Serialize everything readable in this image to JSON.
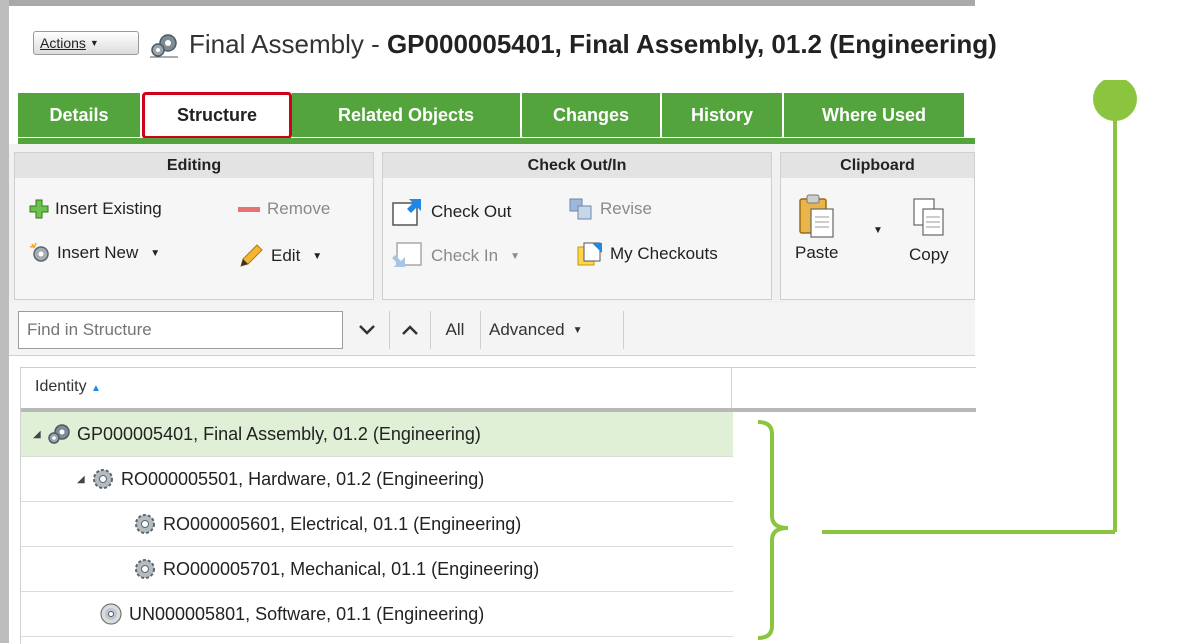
{
  "header": {
    "actions_label": "Actions",
    "title_prefix": "Final Assembly",
    "title_sep": " - ",
    "title_bold": "GP000005401, Final Assembly, 01.2 (Engineering)"
  },
  "tabs": [
    {
      "label": "Details"
    },
    {
      "label": "Structure"
    },
    {
      "label": "Related Objects"
    },
    {
      "label": "Changes"
    },
    {
      "label": "History"
    },
    {
      "label": "Where Used"
    }
  ],
  "toolbar": {
    "editing": {
      "title": "Editing",
      "insert_existing": "Insert Existing",
      "remove": "Remove",
      "insert_new": "Insert New",
      "edit": "Edit"
    },
    "checkout": {
      "title": "Check Out/In",
      "check_out": "Check Out",
      "revise": "Revise",
      "check_in": "Check In",
      "my_checkouts": "My Checkouts"
    },
    "clipboard": {
      "title": "Clipboard",
      "paste": "Paste",
      "copy": "Copy"
    }
  },
  "find": {
    "placeholder": "Find in Structure",
    "all": "All",
    "advanced": "Advanced"
  },
  "grid": {
    "column_header": "Identity",
    "rows": [
      {
        "label": "GP000005401, Final Assembly, 01.2 (Engineering)"
      },
      {
        "label": "RO000005501, Hardware, 01.2 (Engineering)"
      },
      {
        "label": "RO000005601, Electrical, 01.1 (Engineering)"
      },
      {
        "label": "RO000005701, Mechanical, 01.1 (Engineering)"
      },
      {
        "label": "UN000005801, Software, 01.1 (Engineering)"
      }
    ]
  },
  "colors": {
    "tab_green": "#54a43e",
    "active_tab_border": "#d0021b",
    "selected_row": "#dff0d6",
    "callout": "#8bc53f"
  }
}
